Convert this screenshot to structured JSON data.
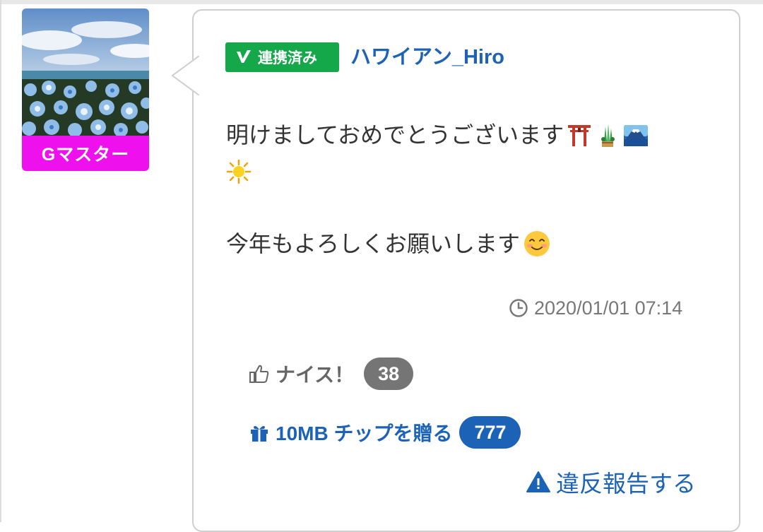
{
  "user": {
    "rank": "Gマスター",
    "linked_badge": "連携済み",
    "name": "ハワイアン_Hiro"
  },
  "post": {
    "line1": "明けましておめでとうございます",
    "line2": "今年もよろしくお願いします",
    "emojis_line1": [
      "torii-icon",
      "kadomatsu-icon",
      "mount-fuji-icon"
    ],
    "emojis_line1b": [
      "sparkle-sun-icon"
    ],
    "emoji_line2": "smiling-face-icon",
    "timestamp": "2020/01/01 07:14"
  },
  "actions": {
    "nice_label": "ナイス！",
    "nice_count": "38",
    "tip_label": "10MB チップを贈る",
    "tip_count": "777",
    "report_label": "違反報告する"
  },
  "colors": {
    "link_blue": "#1c63b7",
    "badge_green": "#15a84a",
    "rank_magenta": "#ee11ee",
    "count_gray": "#757575"
  }
}
